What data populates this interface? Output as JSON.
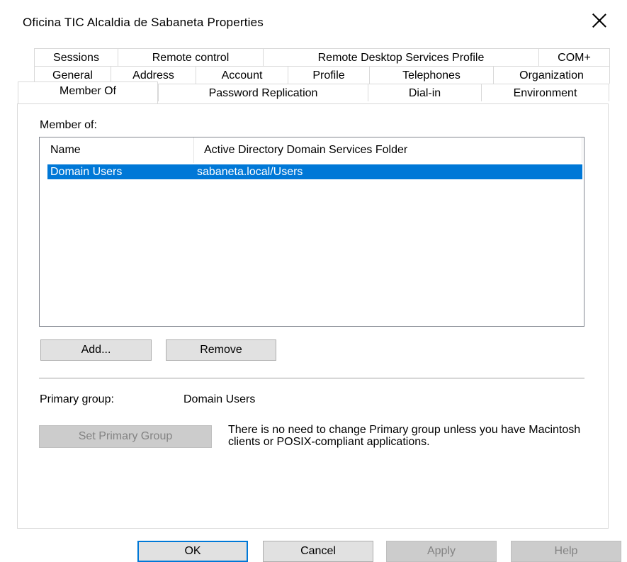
{
  "window": {
    "title": "Oficina TIC Alcaldia de Sabaneta Properties"
  },
  "tabs": {
    "row1": [
      "Sessions",
      "Remote control",
      "Remote Desktop Services Profile",
      "COM+"
    ],
    "row2": [
      "General",
      "Address",
      "Account",
      "Profile",
      "Telephones",
      "Organization"
    ],
    "row3": [
      "Member Of",
      "Password Replication",
      "Dial-in",
      "Environment"
    ],
    "active": "Member Of"
  },
  "member_of": {
    "label": "Member of:",
    "columns": [
      "Name",
      "Active Directory Domain Services Folder"
    ],
    "rows": [
      {
        "name": "Domain Users",
        "folder": "sabaneta.local/Users",
        "selected": true
      }
    ],
    "add_label": "Add...",
    "remove_label": "Remove"
  },
  "primary_group": {
    "label": "Primary group:",
    "value": "Domain Users",
    "set_button_label": "Set Primary Group",
    "info_text": "There is no need to change Primary group unless you have Macintosh clients or POSIX-compliant applications."
  },
  "footer": {
    "ok_label": "OK",
    "cancel_label": "Cancel",
    "apply_label": "Apply",
    "help_label": "Help"
  },
  "colors": {
    "selection": "#0078d7",
    "default_button_border": "#0078d7"
  }
}
